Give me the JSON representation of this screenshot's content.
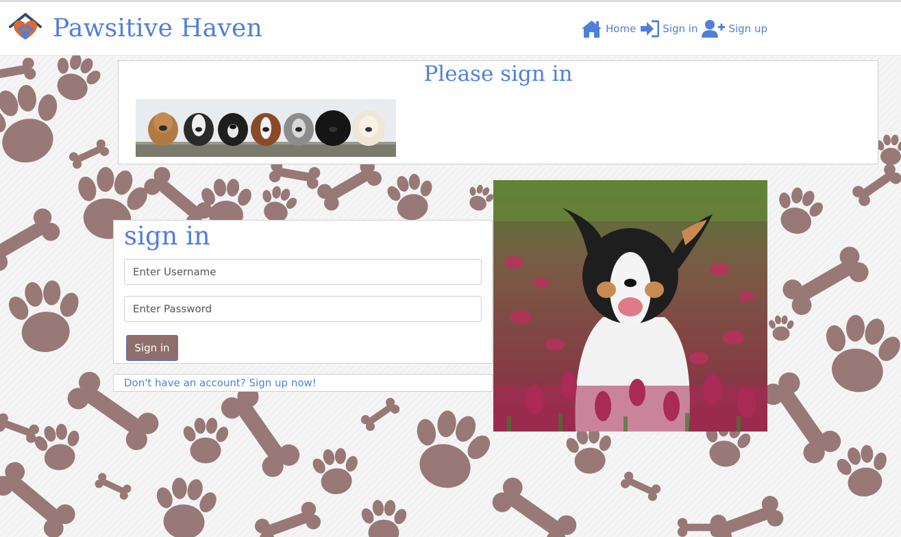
{
  "brand": {
    "name": "Pawsitive Haven"
  },
  "nav": [
    {
      "label": "Home",
      "icon": "home-icon"
    },
    {
      "label": "Sign in",
      "icon": "sign-in-icon"
    },
    {
      "label": "Sign up",
      "icon": "user-plus-icon"
    }
  ],
  "header": {
    "title": "Please sign in"
  },
  "signin": {
    "heading": "sign in",
    "username_placeholder": "Enter Username",
    "password_placeholder": "Enter Password",
    "button_label": "Sign in"
  },
  "signup": {
    "link_text": "Don't have an account? Sign up now!"
  },
  "colors": {
    "accent": "#4f7fd9",
    "button": "#8f6e6b",
    "paw_pattern": "#8f6e6b",
    "logo_orange": "#e0682b",
    "logo_roof": "#2f4a6e"
  }
}
